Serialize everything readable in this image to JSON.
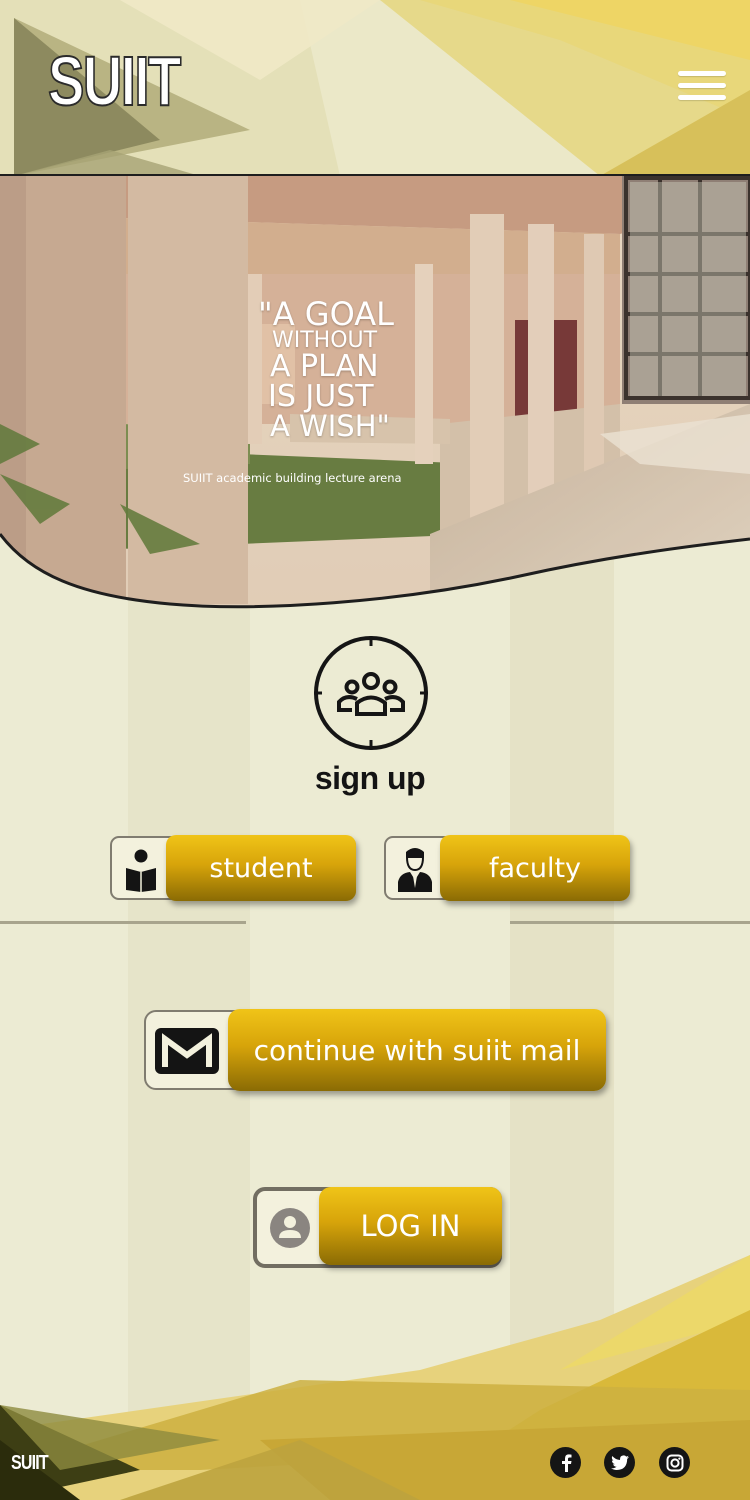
{
  "header": {
    "logo": "SUIIT",
    "menu_icon": "hamburger-menu-icon"
  },
  "hero": {
    "quote_lines": [
      "\"A GOAL",
      "WITHOUT",
      "A PLAN",
      "IS JUST",
      "A WISH\""
    ],
    "caption": "SUIIT academic building lecture arena"
  },
  "signup": {
    "icon": "group-icon",
    "title": "sign up",
    "student": {
      "label": "student",
      "icon": "student-reading-icon"
    },
    "faculty": {
      "label": "faculty",
      "icon": "faculty-person-icon"
    }
  },
  "mail": {
    "label": "continue with suiit mail",
    "icon": "gmail-icon"
  },
  "login": {
    "label": "LOG IN",
    "icon": "user-circle-icon"
  },
  "footer": {
    "logo": "SUIIT",
    "social": [
      "facebook-icon",
      "twitter-icon",
      "instagram-icon"
    ]
  },
  "colors": {
    "accent_gold": "#d7a40a",
    "background": "#ecebd3"
  }
}
